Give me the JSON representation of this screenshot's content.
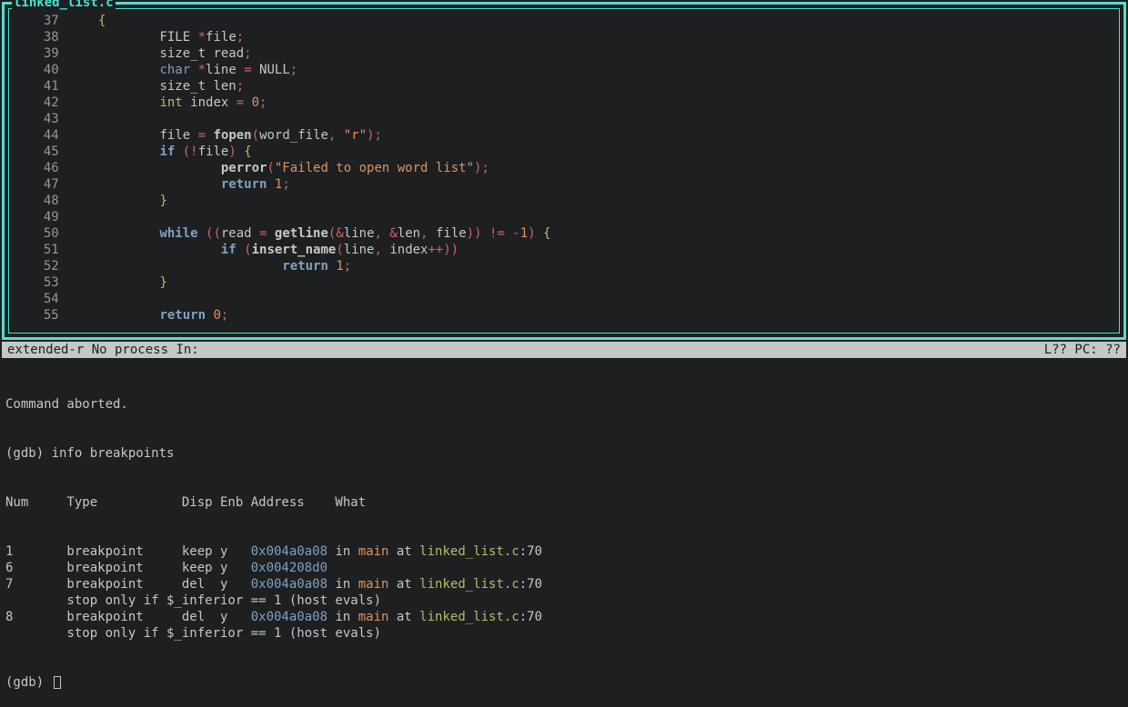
{
  "source": {
    "filename": "linked_list.c",
    "lines": [
      {
        "num": 37,
        "tokens": [
          [
            "{",
            "brace"
          ]
        ]
      },
      {
        "num": 38,
        "tokens": [
          [
            "        ",
            "ident"
          ],
          [
            "FILE ",
            "ident"
          ],
          [
            "*",
            "op"
          ],
          [
            "file",
            "ident"
          ],
          [
            ";",
            "op"
          ]
        ]
      },
      {
        "num": 39,
        "tokens": [
          [
            "        ",
            "ident"
          ],
          [
            "size_t read",
            "ident"
          ],
          [
            ";",
            "op"
          ]
        ]
      },
      {
        "num": 40,
        "tokens": [
          [
            "        ",
            "ident"
          ],
          [
            "char ",
            "type"
          ],
          [
            "*",
            "op"
          ],
          [
            "line ",
            "ident"
          ],
          [
            "=",
            "op"
          ],
          [
            " NULL",
            "ident"
          ],
          [
            ";",
            "op"
          ]
        ]
      },
      {
        "num": 41,
        "tokens": [
          [
            "        ",
            "ident"
          ],
          [
            "size_t len",
            "ident"
          ],
          [
            ";",
            "op"
          ]
        ]
      },
      {
        "num": 42,
        "tokens": [
          [
            "        ",
            "ident"
          ],
          [
            "int ",
            "int"
          ],
          [
            "index ",
            "ident"
          ],
          [
            "=",
            "op"
          ],
          [
            " ",
            "ident"
          ],
          [
            "0",
            "num"
          ],
          [
            ";",
            "op"
          ]
        ]
      },
      {
        "num": 43,
        "tokens": []
      },
      {
        "num": 44,
        "tokens": [
          [
            "        ",
            "ident"
          ],
          [
            "file ",
            "ident"
          ],
          [
            "=",
            "op"
          ],
          [
            " ",
            "ident"
          ],
          [
            "fopen",
            "func"
          ],
          [
            "(",
            "op"
          ],
          [
            "word_file",
            "ident"
          ],
          [
            ",",
            "op"
          ],
          [
            " ",
            "ident"
          ],
          [
            "\"r\"",
            "str"
          ],
          [
            ")",
            "op"
          ],
          [
            ";",
            "op"
          ]
        ]
      },
      {
        "num": 45,
        "tokens": [
          [
            "        ",
            "ident"
          ],
          [
            "if ",
            "kw"
          ],
          [
            "(",
            "op"
          ],
          [
            "!",
            "op"
          ],
          [
            "file",
            "ident"
          ],
          [
            ")",
            "op"
          ],
          [
            " ",
            "ident"
          ],
          [
            "{",
            "brace"
          ]
        ]
      },
      {
        "num": 46,
        "tokens": [
          [
            "                ",
            "ident"
          ],
          [
            "perror",
            "func"
          ],
          [
            "(",
            "op"
          ],
          [
            "\"Failed to open word list\"",
            "str"
          ],
          [
            ")",
            "op"
          ],
          [
            ";",
            "op"
          ]
        ]
      },
      {
        "num": 47,
        "tokens": [
          [
            "                ",
            "ident"
          ],
          [
            "return ",
            "kw"
          ],
          [
            "1",
            "num"
          ],
          [
            ";",
            "op"
          ]
        ]
      },
      {
        "num": 48,
        "tokens": [
          [
            "        ",
            "ident"
          ],
          [
            "}",
            "brace"
          ]
        ]
      },
      {
        "num": 49,
        "tokens": []
      },
      {
        "num": 50,
        "tokens": [
          [
            "        ",
            "ident"
          ],
          [
            "while ",
            "kw"
          ],
          [
            "((",
            "op"
          ],
          [
            "read ",
            "ident"
          ],
          [
            "=",
            "op"
          ],
          [
            " ",
            "ident"
          ],
          [
            "getline",
            "func"
          ],
          [
            "(",
            "op"
          ],
          [
            "&",
            "op"
          ],
          [
            "line",
            "ident"
          ],
          [
            ",",
            "op"
          ],
          [
            " ",
            "ident"
          ],
          [
            "&",
            "op"
          ],
          [
            "len",
            "ident"
          ],
          [
            ",",
            "op"
          ],
          [
            " file",
            "ident"
          ],
          [
            "))",
            "op"
          ],
          [
            " ",
            "ident"
          ],
          [
            "!=",
            "op"
          ],
          [
            " ",
            "ident"
          ],
          [
            "-",
            "op"
          ],
          [
            "1",
            "num"
          ],
          [
            ")",
            "op"
          ],
          [
            " ",
            "ident"
          ],
          [
            "{",
            "brace"
          ]
        ]
      },
      {
        "num": 51,
        "tokens": [
          [
            "                ",
            "ident"
          ],
          [
            "if ",
            "kw"
          ],
          [
            "(",
            "op"
          ],
          [
            "insert_name",
            "func"
          ],
          [
            "(",
            "op"
          ],
          [
            "line",
            "ident"
          ],
          [
            ",",
            "op"
          ],
          [
            " index",
            "ident"
          ],
          [
            "++",
            "op"
          ],
          [
            "))",
            "op"
          ]
        ]
      },
      {
        "num": 52,
        "tokens": [
          [
            "                        ",
            "ident"
          ],
          [
            "return ",
            "kw"
          ],
          [
            "1",
            "num"
          ],
          [
            ";",
            "op"
          ]
        ]
      },
      {
        "num": 53,
        "tokens": [
          [
            "        ",
            "ident"
          ],
          [
            "}",
            "brace"
          ]
        ]
      },
      {
        "num": 54,
        "tokens": []
      },
      {
        "num": 55,
        "tokens": [
          [
            "        ",
            "ident"
          ],
          [
            "return ",
            "kw"
          ],
          [
            "0",
            "num"
          ],
          [
            ";",
            "op"
          ]
        ]
      }
    ]
  },
  "status": {
    "left": "extended-r No process In:",
    "right": "L??   PC: ??"
  },
  "gdb": {
    "aborted": "Command aborted.",
    "prompt_info": "(gdb) info breakpoints",
    "header": "Num     Type           Disp Enb Address    What",
    "breakpoints": [
      {
        "num": "1",
        "type": "breakpoint",
        "disp": "keep",
        "enb": "y",
        "addr": "0x004a0a08",
        "what_in": "in",
        "func": "main",
        "at": "at",
        "file": "linked_list.c",
        "line": ":70",
        "cond": null
      },
      {
        "num": "6",
        "type": "breakpoint",
        "disp": "keep",
        "enb": "y",
        "addr": "0x004208d0",
        "what_in": null,
        "func": null,
        "at": null,
        "file": null,
        "line": null,
        "cond": null
      },
      {
        "num": "7",
        "type": "breakpoint",
        "disp": "del ",
        "enb": "y",
        "addr": "0x004a0a08",
        "what_in": "in",
        "func": "main",
        "at": "at",
        "file": "linked_list.c",
        "line": ":70",
        "cond": "        stop only if $_inferior == 1 (host evals)"
      },
      {
        "num": "8",
        "type": "breakpoint",
        "disp": "del ",
        "enb": "y",
        "addr": "0x004a0a08",
        "what_in": "in",
        "func": "main",
        "at": "at",
        "file": "linked_list.c",
        "line": ":70",
        "cond": "        stop only if $_inferior == 1 (host evals)"
      }
    ],
    "prompt": "(gdb) "
  }
}
